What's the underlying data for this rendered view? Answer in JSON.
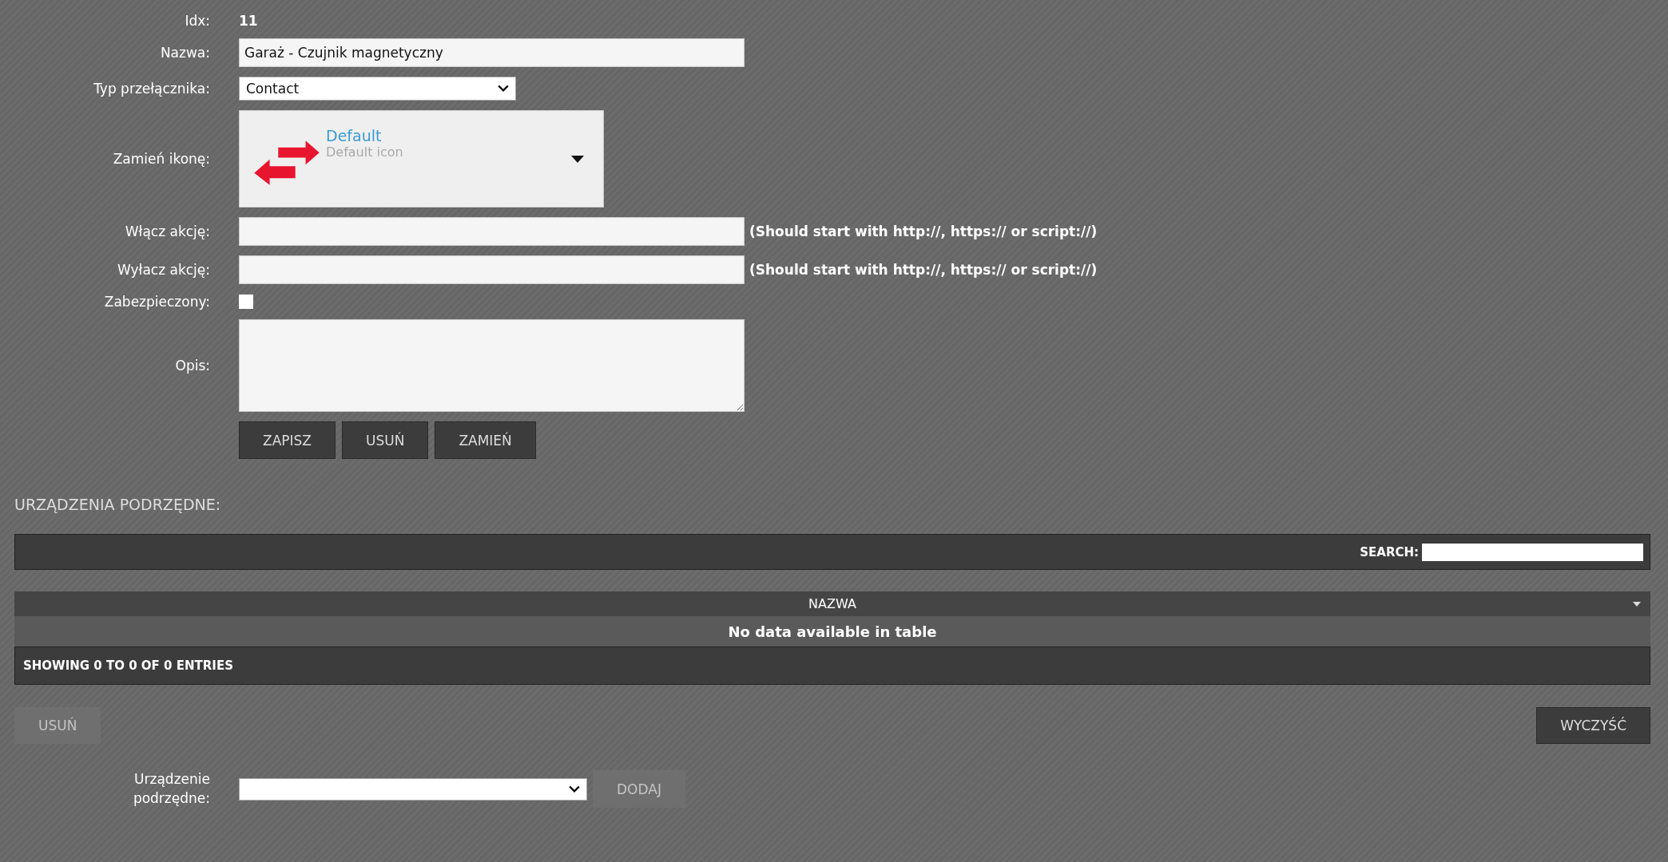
{
  "form": {
    "idx": {
      "label": "Idx:",
      "value": "11"
    },
    "name": {
      "label": "Nazwa:",
      "value": "Garaż - Czujnik magnetyczny"
    },
    "switch_type": {
      "label": "Typ przełącznika:",
      "value": "Contact"
    },
    "icon": {
      "label": "Zamień ikonę:",
      "title": "Default",
      "subtitle": "Default icon"
    },
    "on_action": {
      "label": "Włącz akcję:",
      "hint": "(Should start with http://, https:// or script://)"
    },
    "off_action": {
      "label": "Wyłacz akcję:",
      "hint": "(Should start with http://, https:// or script://)"
    },
    "protected": {
      "label": "Zabezpieczony:",
      "checked": false
    },
    "description": {
      "label": "Opis:"
    },
    "buttons": [
      {
        "label": "ZAPISZ",
        "disabled": false
      },
      {
        "label": "USUŃ",
        "disabled": false
      },
      {
        "label": "ZAMIEŃ",
        "disabled": false
      }
    ]
  },
  "subdevices": {
    "title": "URZĄDZENIA PODRZĘDNE:",
    "search": {
      "label": "SEARCH:"
    },
    "table": {
      "columns": [
        "NAZWA"
      ],
      "empty_text": "No data available in table",
      "footer": "SHOWING 0 TO 0 OF 0 ENTRIES"
    },
    "remove_button": {
      "label": "USUŃ",
      "disabled": true
    },
    "clear_button": {
      "label": "WYCZYŚĆ",
      "disabled": false
    },
    "add": {
      "label": "Urządzenie podrzędne:",
      "button": {
        "label": "DODAJ",
        "disabled": true
      }
    }
  }
}
